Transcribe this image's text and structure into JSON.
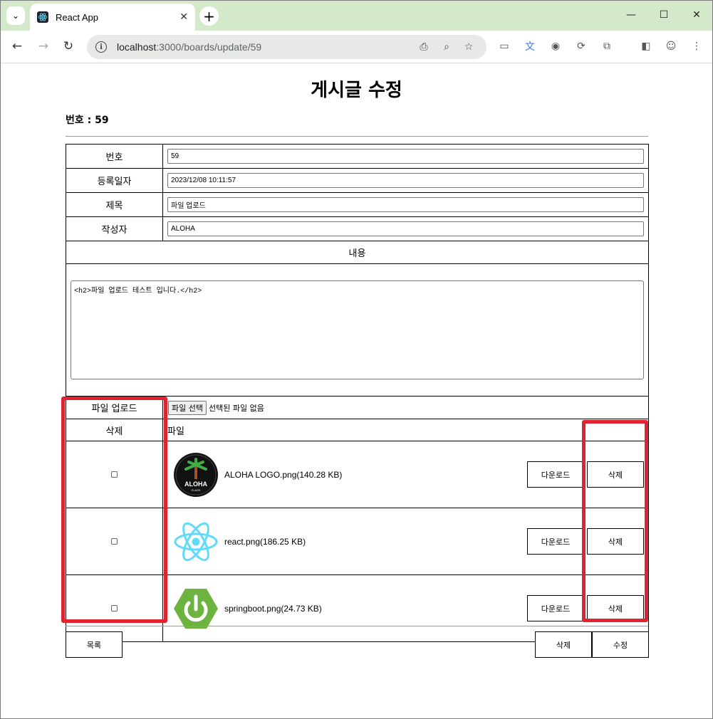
{
  "browser": {
    "tab_title": "React App",
    "url_host": "localhost",
    "url_path": ":3000/boards/update/59"
  },
  "page": {
    "title": "게시글 수정",
    "post_number_label": "번호 : 59"
  },
  "form": {
    "fields": [
      {
        "label": "번호",
        "value": "59"
      },
      {
        "label": "등록일자",
        "value": "2023/12/08 10:11:57"
      },
      {
        "label": "제목",
        "value": "파일 업로드"
      },
      {
        "label": "작성자",
        "value": "ALOHA"
      }
    ],
    "content_label": "내용",
    "content_value": "<h2>파일 업로드 테스트 입니다.</h2>",
    "upload_label": "파일 업로드",
    "file_select_button": "파일 선택",
    "file_none": "선택된 파일 없음"
  },
  "files": {
    "header_delete": "삭제",
    "header_file": "파일",
    "download_label": "다운로드",
    "delete_label": "삭제",
    "items": [
      {
        "name": "ALOHA LOGO.png(140.28 KB)",
        "icon": "aloha-logo"
      },
      {
        "name": "react.png(186.25 KB)",
        "icon": "react-logo"
      },
      {
        "name": "springboot.png(24.73 KB)",
        "icon": "springboot-logo"
      }
    ]
  },
  "bottom": {
    "list_button": "목록",
    "delete_button": "삭제",
    "update_button": "수정"
  },
  "colors": {
    "highlight": "#e1232f",
    "tab_bar": "#d3e9c9"
  }
}
